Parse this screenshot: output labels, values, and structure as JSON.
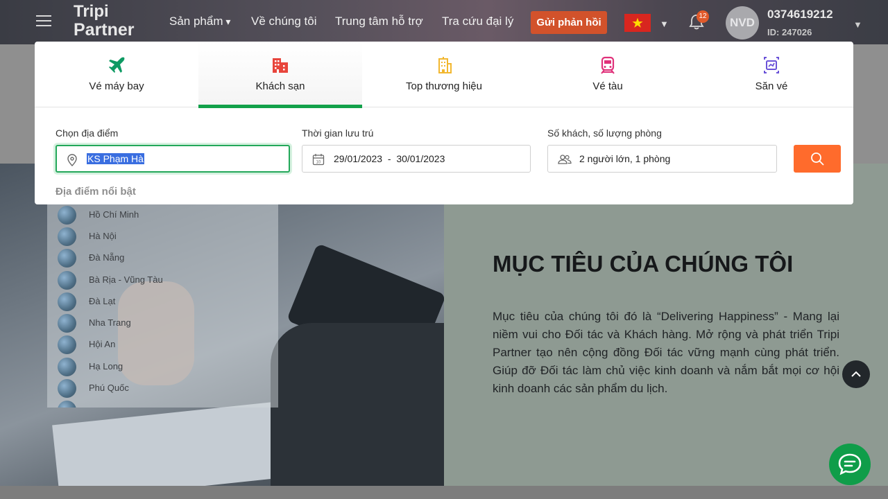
{
  "header": {
    "logo_line1": "Tripi",
    "logo_line2": "Partner",
    "nav": [
      "Sản phẩm",
      "Về chúng tôi",
      "Trung tâm hỗ trợ",
      "Tra cứu đại lý"
    ],
    "feedback_label": "Gửi phản hồi",
    "notification_count": "12",
    "avatar_initials": "NVD",
    "user_phone": "0374619212",
    "user_id": "ID: 247026"
  },
  "tabs": [
    {
      "label": "Vé máy bay",
      "icon": "plane-icon",
      "color": "#0e9a63"
    },
    {
      "label": "Khách sạn",
      "icon": "hotel-icon",
      "color": "#e8453c"
    },
    {
      "label": "Top thương hiệu",
      "icon": "building-icon",
      "color": "#f2b72f"
    },
    {
      "label": "Vé tàu",
      "icon": "train-icon",
      "color": "#e0317a"
    },
    {
      "label": "Săn vé",
      "icon": "ticket-hunt-icon",
      "color": "#6b53d8"
    }
  ],
  "active_tab": "Khách sạn",
  "search": {
    "location_label": "Chọn địa điểm",
    "location_value": "KS Phạm Hà",
    "stay_label": "Thời gian lưu trú",
    "checkin": "29/01/2023",
    "checkout": "30/01/2023",
    "date_separator": "-",
    "guests_label": "Số khách, số lượng phòng",
    "guests_value": "2 người lớn, 1 phòng"
  },
  "dropdown": {
    "title": "Địa điểm nổi bật",
    "items": [
      "Hồ Chí Minh",
      "Hà Nội",
      "Đà Nẵng",
      "Bà Rịa - Vũng Tàu",
      "Đà Lạt",
      "Nha Trang",
      "Hội An",
      "Hạ Long",
      "Phú Quốc"
    ]
  },
  "goal": {
    "title": "MỤC TIÊU CỦA CHÚNG TÔI",
    "text": "Mục tiêu của chúng tôi đó là “Delivering Happiness” - Mang lại niềm vui cho Đối tác và Khách hàng. Mở rộng và phát triển Tripi Partner tạo nên cộng đồng Đối tác vững mạnh cùng phát triển. Giúp đỡ Đối tác làm chủ việc kinh doanh và nắm bắt mọi cơ hội kinh doanh các sản phẩm du lịch."
  },
  "colors": {
    "accent_green": "#12a14a",
    "search_orange": "#ff6b2c",
    "feedback_orange": "#d2522b",
    "chat_green": "#0f9d49"
  }
}
